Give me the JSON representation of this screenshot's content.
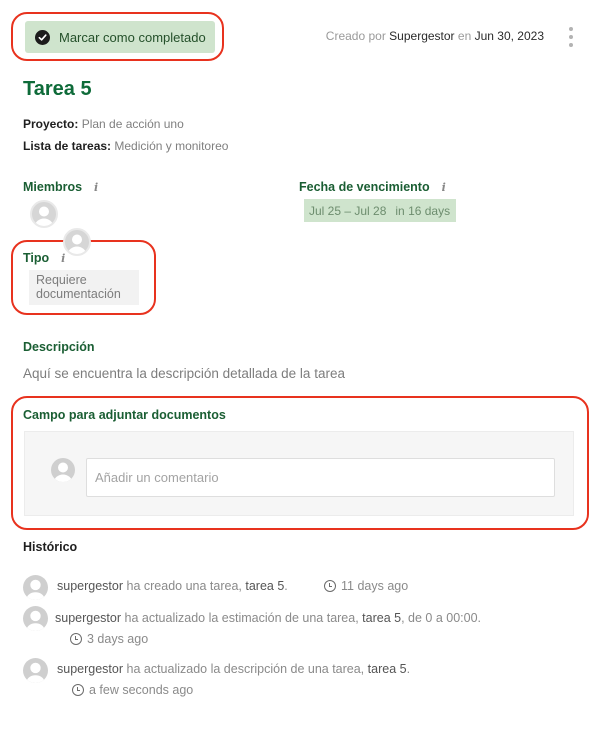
{
  "header": {
    "complete_button": "Marcar como completado",
    "created_prefix": "Creado por",
    "created_by": "Supergestor",
    "created_mid": "en",
    "created_date": "Jun 30, 2023",
    "menu_icon": "kebab-menu-icon"
  },
  "task": {
    "title": "Tarea 5",
    "project_label": "Proyecto:",
    "project_value": "Plan de acción uno",
    "list_label": "Lista de tareas:",
    "list_value": "Medición y monitoreo"
  },
  "members": {
    "label": "Miembros",
    "info": "i"
  },
  "due": {
    "label": "Fecha de vencimiento",
    "info": "i",
    "range": "Jul 25 – Jul 28",
    "relative": "in 16 days"
  },
  "type": {
    "label": "Tipo",
    "info": "i",
    "value_line1": "Requiere",
    "value_line2": "documentación"
  },
  "description": {
    "label": "Descripción",
    "text": "Aquí se encuentra la descripción detallada de la tarea"
  },
  "attachments": {
    "label": "Campo para adjuntar documentos",
    "comment_placeholder": "Añadir un comentario"
  },
  "history": {
    "label": "Histórico",
    "entries": [
      {
        "user": "supergestor",
        "action": "ha creado una tarea,",
        "target": "tarea 5",
        "suffix": ".",
        "time": "11 days ago"
      },
      {
        "user": "supergestor",
        "action": "ha actualizado la estimación de una tarea,",
        "target": "tarea 5",
        "suffix": ", de 0 a 00:00.",
        "time": "3 days ago"
      },
      {
        "user": "supergestor",
        "action": "ha actualizado la descripción de una tarea,",
        "target": "tarea 5",
        "suffix": ".",
        "time": "a few seconds ago"
      }
    ]
  },
  "colors": {
    "accent_green": "#0e6b39",
    "badge_green": "#cfe4cd",
    "highlight_red": "#e8321e"
  }
}
